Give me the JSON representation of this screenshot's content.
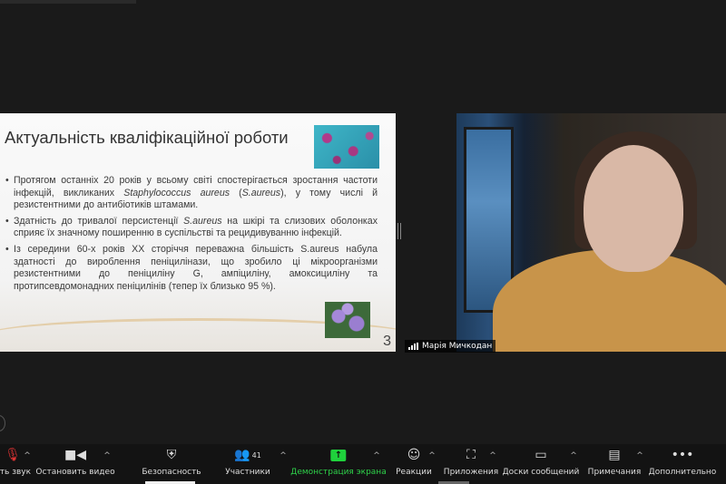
{
  "slide": {
    "title": "Актуальність кваліфікаційної роботи",
    "bullets": [
      [
        "Протягом останніх 20 років у всьому світі спостерігається зростання частоти інфекцій, викликаних ",
        "Staphylococcus aureus",
        " (",
        "S.aureus",
        "), у тому числі й резистентними до антибіотиків штамами."
      ],
      [
        "Здатність до тривалої персистенції ",
        "S.aureus",
        " на шкірі та слизових оболонках сприяє їх значному поширенню в суспільстві та рецидивуванню інфекцій.",
        "",
        ""
      ],
      [
        "Із середини 60-х років XX сторіччя переважна більшість S.aureus набула здатності до вироблення пеніцилінази, що зробило ці мікроорганізми резистентними до пеніциліну G, ампіциліну, амоксициліну та протипсевдомонадних пеніцилінів (тепер їх близько 95 %).",
        "",
        "",
        "",
        ""
      ]
    ],
    "page_number": "3"
  },
  "participant": {
    "name": "Марія Мичкодан"
  },
  "toolbar": {
    "mute": "ить звук",
    "video": "Остановить видео",
    "security": "Безопасность",
    "participants": "Участники",
    "participants_count": "41",
    "share": "Демонстрация экрана",
    "reactions": "Реакции",
    "apps": "Приложения",
    "whiteboards": "Доски сообщений",
    "notes": "Примечания",
    "more": "Дополнительно"
  },
  "colors": {
    "share_green": "#2ed24a",
    "background": "#1a1a1a"
  }
}
